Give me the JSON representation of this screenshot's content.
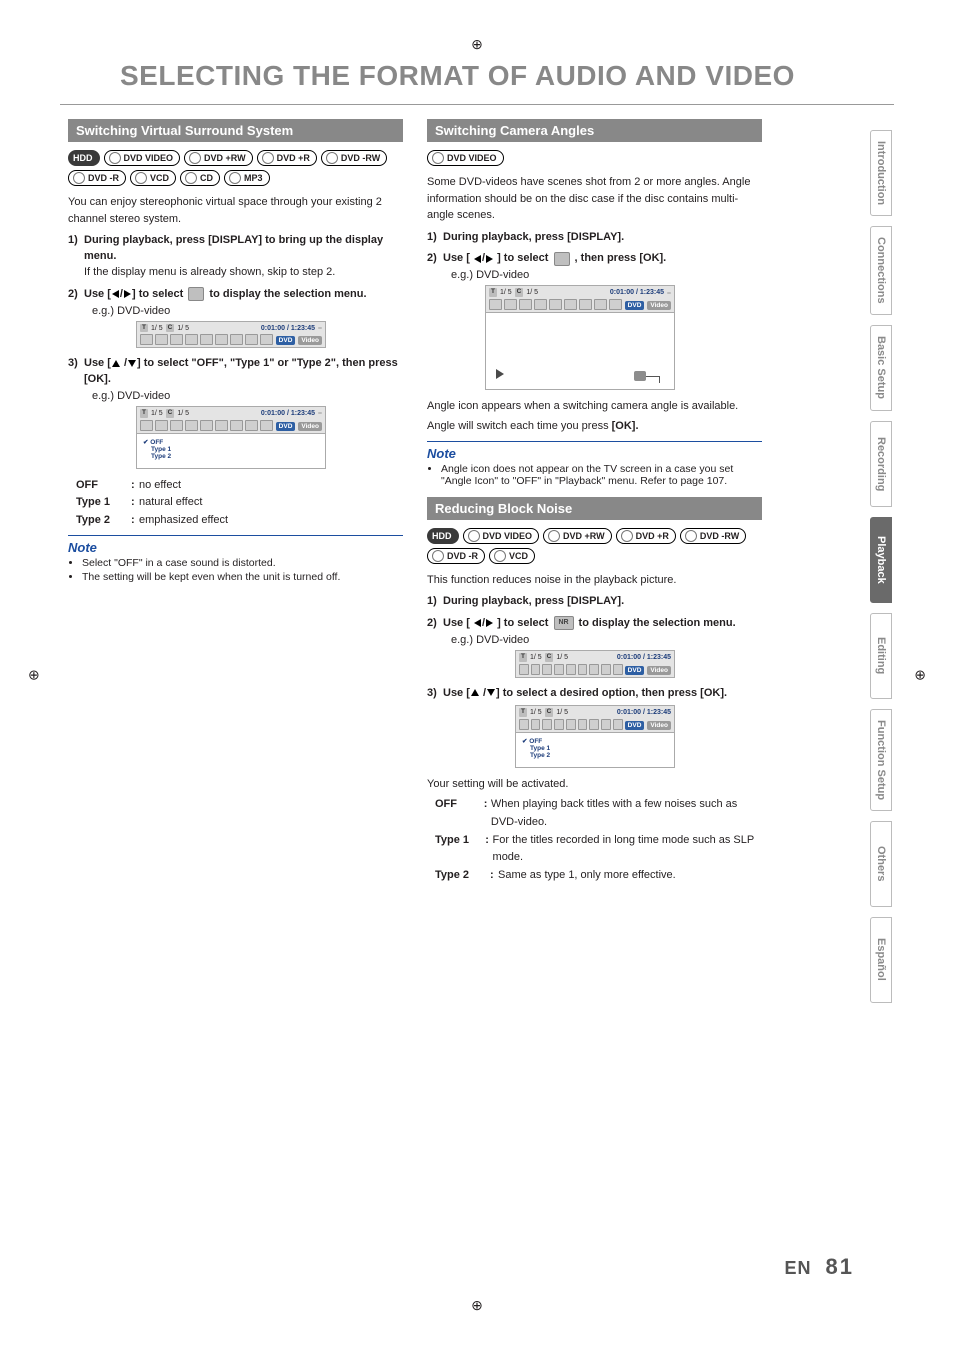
{
  "title": "SELECTING THE FORMAT OF AUDIO AND VIDEO",
  "tabs": [
    "Introduction",
    "Connections",
    "Basic Setup",
    "Recording",
    "Playback",
    "Editing",
    "Function Setup",
    "Others",
    "Español"
  ],
  "active_tab": "Playback",
  "page_lang": "EN",
  "page_no": "81",
  "left": {
    "section": "Switching Virtual Surround System",
    "badges": [
      "HDD",
      "DVD VIDEO",
      "DVD +RW",
      "DVD +R",
      "DVD -RW",
      "DVD -R",
      "VCD",
      "CD",
      "MP3"
    ],
    "intro": "You can enjoy stereophonic virtual space through your existing 2 channel stereo system.",
    "s1_bold": "During playback, press [DISPLAY] to bring up the display menu.",
    "s1_body": "If the display menu is already shown, skip to step 2.",
    "s2_pre": "Use [",
    "s2_mid": "] to select ",
    "s2_post": " to display the selection menu.",
    "eg": "e.g.) DVD-video",
    "s3_pre": "Use [",
    "s3_mid": "] to select \"OFF\", \"Type 1\" or \"Type 2\", then press [OK].",
    "opts": {
      "OFF": "no effect",
      "Type 1": "natural effect",
      "Type 2": "emphasized effect"
    },
    "note_h": "Note",
    "notes": [
      "Select \"OFF\" in a case sound is distorted.",
      "The setting will be kept even when the unit is turned off."
    ],
    "osd": {
      "title_left": "1/   5",
      "chapter": "1/   5",
      "time": "0:01:00 / 1:23:45",
      "media1": "DVD",
      "media2": "Video",
      "menu": [
        "OFF",
        "Type 1",
        "Type 2"
      ]
    }
  },
  "right": {
    "section1": "Switching Camera Angles",
    "badges1": [
      "DVD VIDEO"
    ],
    "intro1": "Some DVD-videos have scenes shot from 2 or more angles. Angle information should be on the disc case if the disc contains multi-angle scenes.",
    "r1_s1": "During playback, press [DISPLAY].",
    "r1_s2_pre": "Use [ ",
    "r1_s2_mid": " ] to select ",
    "r1_s2_post": " , then press [OK].",
    "eg": "e.g.) DVD-video",
    "r1_body1": "Angle icon appears when a switching camera angle is available.",
    "r1_body2_pre": "Angle will switch each time you press ",
    "r1_body2_key": "[OK].",
    "note_h": "Note",
    "notes1": [
      "Angle icon does not appear on the TV screen in a case you set \"Angle Icon\" to \"OFF\" in \"Playback\" menu. Refer to page 107."
    ],
    "section2": "Reducing Block Noise",
    "badges2": [
      "HDD",
      "DVD VIDEO",
      "DVD +RW",
      "DVD +R",
      "DVD -RW",
      "DVD -R",
      "VCD"
    ],
    "intro2": "This function reduces noise in the playback picture.",
    "r2_s1": "During playback, press [DISPLAY].",
    "r2_s2_pre": "Use [ ",
    "r2_s2_mid": " ] to select ",
    "r2_s2_icon": "NR",
    "r2_s2_post": " to display the selection menu.",
    "r2_s3_pre": "Use [",
    "r2_s3_post": "] to select a desired option, then press [OK].",
    "r2_act": "Your setting will be activated.",
    "opts2": {
      "OFF": "When playing back titles with a few noises such as DVD-video.",
      "Type 1": "For the titles recorded in long time mode such as SLP mode.",
      "Type 2": "Same as type 1, only more effective."
    },
    "osd": {
      "title_left": "1/   5",
      "chapter": "1/   5",
      "time": "0:01:00 / 1:23:45",
      "media1": "DVD",
      "media2": "Video",
      "menu": [
        "OFF",
        "Type 1",
        "Type 2"
      ]
    }
  }
}
